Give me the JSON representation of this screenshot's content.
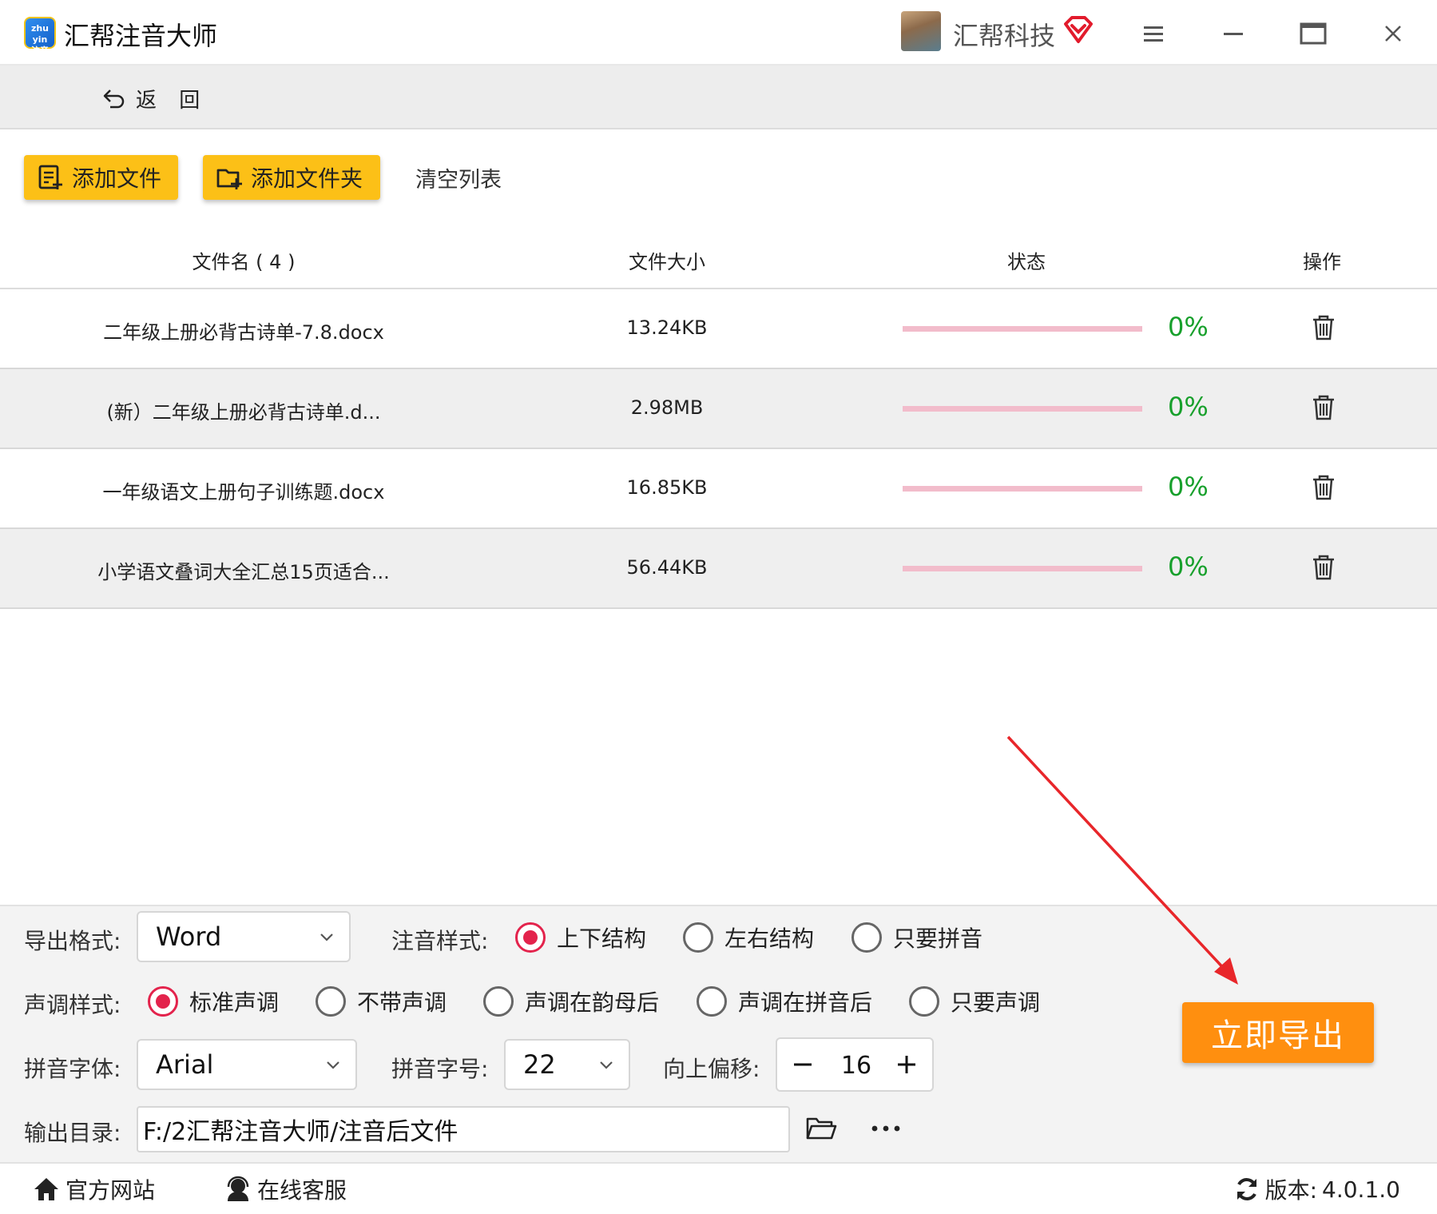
{
  "app": {
    "title": "汇帮注音大师",
    "logo_text": "注音"
  },
  "user": {
    "name": "汇帮科技"
  },
  "nav": {
    "back_label": "返 回"
  },
  "toolbar": {
    "add_file_label": "添加文件",
    "add_folder_label": "添加文件夹",
    "clear_list_label": "清空列表"
  },
  "table": {
    "headers": {
      "name": "文件名 ( 4 )",
      "size": "文件大小",
      "status": "状态",
      "action": "操作"
    },
    "rows": [
      {
        "name": "二年级上册必背古诗单-7.8.docx",
        "size": "13.24KB",
        "progress": 0,
        "progress_text": "0%"
      },
      {
        "name": "(新）二年级上册必背古诗单.d...",
        "size": "2.98MB",
        "progress": 0,
        "progress_text": "0%"
      },
      {
        "name": "一年级语文上册句子训练题.docx",
        "size": "16.85KB",
        "progress": 0,
        "progress_text": "0%"
      },
      {
        "name": "小学语文叠词大全汇总15页适合...",
        "size": "56.44KB",
        "progress": 0,
        "progress_text": "0%"
      }
    ]
  },
  "settings": {
    "export_format": {
      "label": "导出格式:",
      "value": "Word"
    },
    "annotation_style": {
      "label": "注音样式:",
      "options": [
        "上下结构",
        "左右结构",
        "只要拼音"
      ],
      "selected": "上下结构"
    },
    "tone_style": {
      "label": "声调样式:",
      "options": [
        "标准声调",
        "不带声调",
        "声调在韵母后",
        "声调在拼音后",
        "只要声调"
      ],
      "selected": "标准声调"
    },
    "pinyin_font": {
      "label": "拼音字体:",
      "value": "Arial"
    },
    "pinyin_size": {
      "label": "拼音字号:",
      "value": "22"
    },
    "offset": {
      "label": "向上偏移:",
      "value": "16"
    },
    "output_dir": {
      "label": "输出目录:",
      "value": "F:/2汇帮注音大师/注音后文件"
    },
    "export_button": "立即导出"
  },
  "footer": {
    "website_label": "官方网站",
    "support_label": "在线客服",
    "version_label": "版本:",
    "version_value": "4.0.1.0"
  },
  "colors": {
    "accent_yellow": "#fcc017",
    "export_orange": "#ff8f0f",
    "radio_selected": "#e3234c",
    "progress_track": "#f2bccb",
    "percent_green": "#18a02c",
    "annotation_arrow": "#e8262a"
  }
}
